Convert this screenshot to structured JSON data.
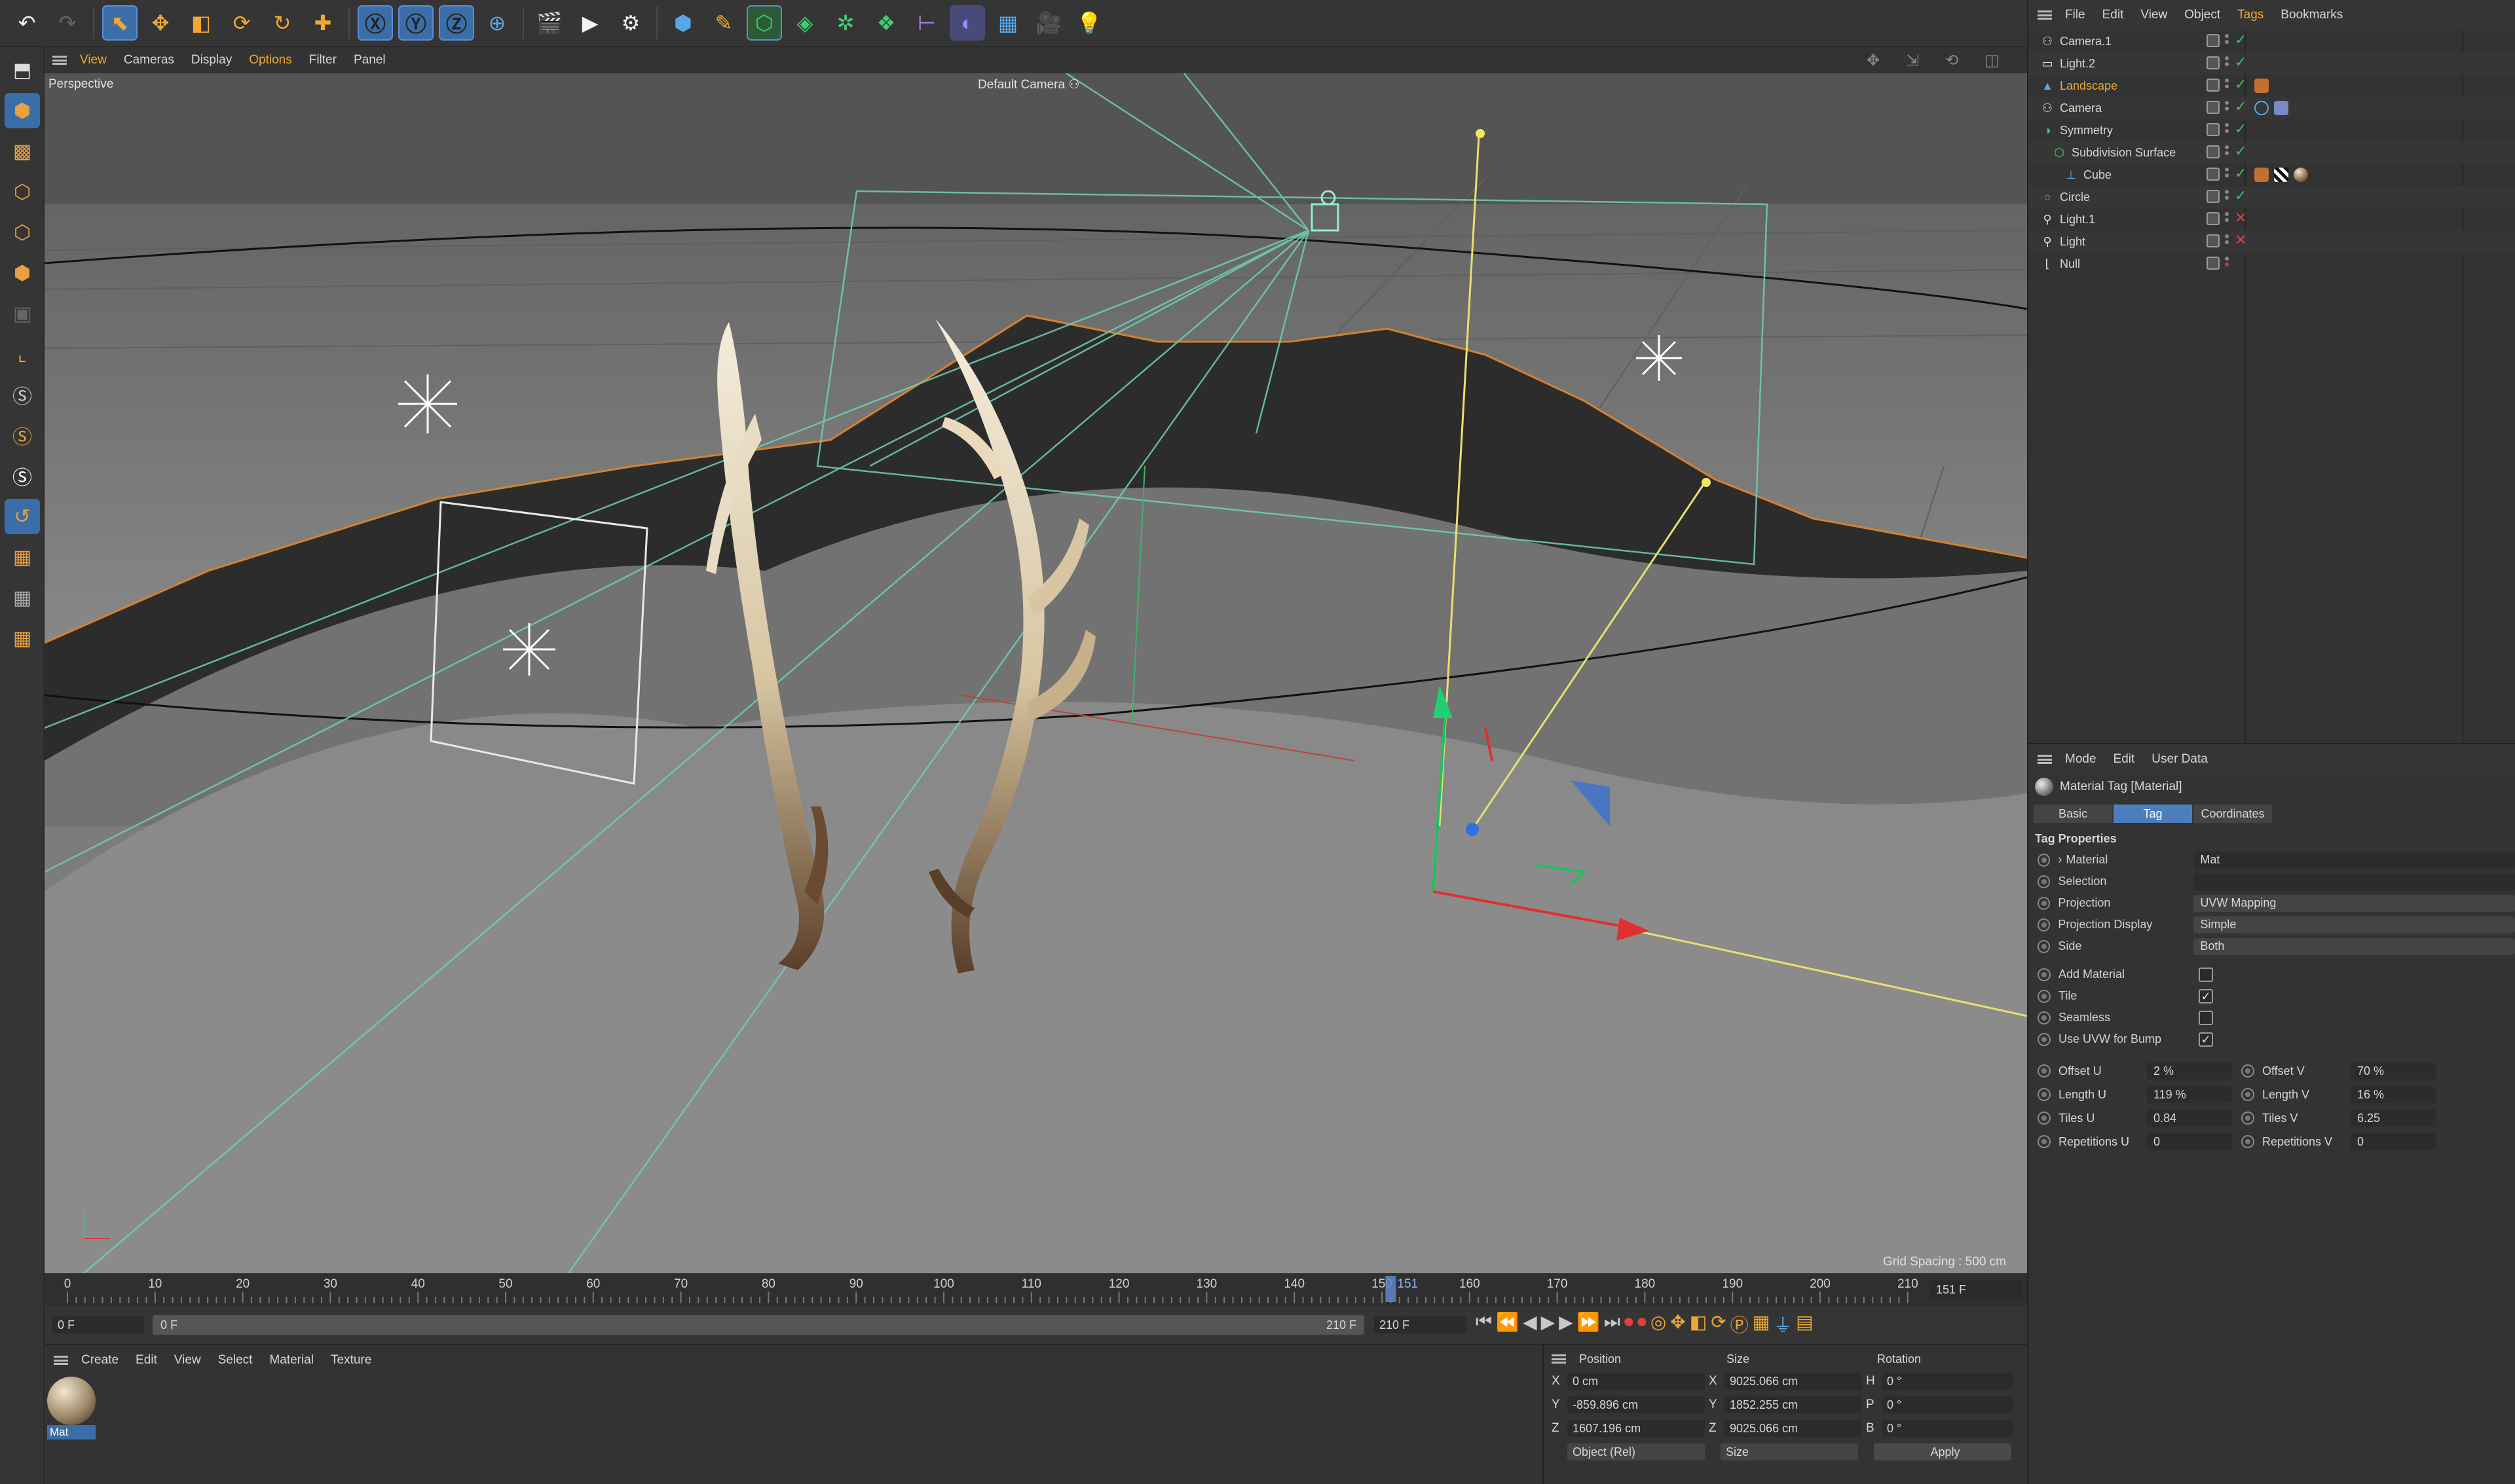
{
  "toolbar": {
    "icons": [
      "undo-icon",
      "redo-icon",
      "live-select-icon",
      "move-icon",
      "scale-icon",
      "rotate-icon",
      "recent-tool-icon",
      "coordinate-icon",
      "x-axis-icon",
      "y-axis-icon",
      "z-axis-icon",
      "world-coord-icon",
      "render-view-icon",
      "render-picture-viewer-icon",
      "render-settings-icon",
      "cube-icon",
      "pen-icon",
      "subdivision-icon",
      "extrude-icon",
      "cloner-icon",
      "array-icon",
      "deformer-icon",
      "field-icon",
      "floor-icon",
      "camera-icon",
      "light-icon"
    ]
  },
  "viewport": {
    "menu": [
      "View",
      "Cameras",
      "Display",
      "Options",
      "Filter",
      "Panel"
    ],
    "active_menu": "Options",
    "label": "Perspective",
    "camera": "Default Camera",
    "grid_spacing": "Grid Spacing : 500 cm"
  },
  "objects": {
    "menu": [
      "File",
      "Edit",
      "View",
      "Object",
      "Tags",
      "Bookmarks"
    ],
    "active_menu": "Tags",
    "items": [
      {
        "name": "Camera.1",
        "indent": 0,
        "icon": "camera-icon",
        "status": "check"
      },
      {
        "name": "Light.2",
        "indent": 0,
        "icon": "area-light-icon",
        "status": "check"
      },
      {
        "name": "Landscape",
        "indent": 0,
        "icon": "landscape-icon",
        "status": "check",
        "highlight": true
      },
      {
        "name": "Camera",
        "indent": 0,
        "icon": "camera-icon",
        "status": "check"
      },
      {
        "name": "Symmetry",
        "indent": 0,
        "icon": "symmetry-icon",
        "status": "check"
      },
      {
        "name": "Subdivision Surface",
        "indent": 1,
        "icon": "subdivision-icon",
        "status": "check"
      },
      {
        "name": "Cube",
        "indent": 2,
        "icon": "cube-icon",
        "status": "check"
      },
      {
        "name": "Circle",
        "indent": 0,
        "icon": "circle-icon",
        "status": "check"
      },
      {
        "name": "Light.1",
        "indent": 0,
        "icon": "light-icon",
        "status": "x"
      },
      {
        "name": "Light",
        "indent": 0,
        "icon": "light-icon",
        "status": "x"
      },
      {
        "name": "Null",
        "indent": 0,
        "icon": "null-icon",
        "status": "none"
      }
    ]
  },
  "attributes": {
    "menu": [
      "Mode",
      "Edit",
      "User Data"
    ],
    "title": "Material Tag [Material]",
    "tabs": [
      "Basic",
      "Tag",
      "Coordinates"
    ],
    "active_tab": "Tag",
    "section": "Tag Properties",
    "material_label": "Material",
    "material_value": "Mat",
    "selection_label": "Selection",
    "projection_label": "Projection",
    "projection_value": "UVW Mapping",
    "projection_display_label": "Projection Display",
    "projection_display_value": "Simple",
    "side_label": "Side",
    "side_value": "Both",
    "add_material_label": "Add Material",
    "tile_label": "Tile",
    "seamless_label": "Seamless",
    "use_uvw_label": "Use UVW for Bump",
    "offset_u_label": "Offset U",
    "offset_u": "2 %",
    "offset_v_label": "Offset V",
    "offset_v": "70 %",
    "length_u_label": "Length U",
    "length_u": "119 %",
    "length_v_label": "Length V",
    "length_v": "16 %",
    "tiles_u_label": "Tiles U",
    "tiles_u": "0.84",
    "tiles_v_label": "Tiles V",
    "tiles_v": "6.25",
    "rep_u_label": "Repetitions U",
    "rep_u": "0",
    "rep_v_label": "Repetitions V",
    "rep_v": "0"
  },
  "timeline": {
    "ticks": [
      "0",
      "10",
      "20",
      "30",
      "40",
      "50",
      "60",
      "70",
      "80",
      "90",
      "100",
      "110",
      "120",
      "130",
      "140",
      "150",
      "160",
      "170",
      "180",
      "190",
      "200",
      "210"
    ],
    "current_frame": "151",
    "current_frame_field": "151 F",
    "start": "0 F",
    "min": "0 F",
    "max": "210 F",
    "end": "210 F"
  },
  "materials": {
    "menu": [
      "Create",
      "Edit",
      "View",
      "Select",
      "Material",
      "Texture"
    ],
    "mat_name": "Mat"
  },
  "coords": {
    "headers": [
      "Position",
      "Size",
      "Rotation"
    ],
    "pos_x": "0 cm",
    "pos_y": "-859.896 cm",
    "pos_z": "1607.196 cm",
    "size_x": "9025.066 cm",
    "size_y": "1852.255 cm",
    "size_z": "9025.066 cm",
    "rot_h": "0 °",
    "rot_p": "0 °",
    "rot_b": "0 °",
    "mode": "Object (Rel)",
    "size_mode": "Size",
    "apply": "Apply",
    "axis_x": "X",
    "axis_y": "Y",
    "axis_z": "Z",
    "axis_h": "H",
    "axis_p": "P",
    "axis_b": "B"
  }
}
